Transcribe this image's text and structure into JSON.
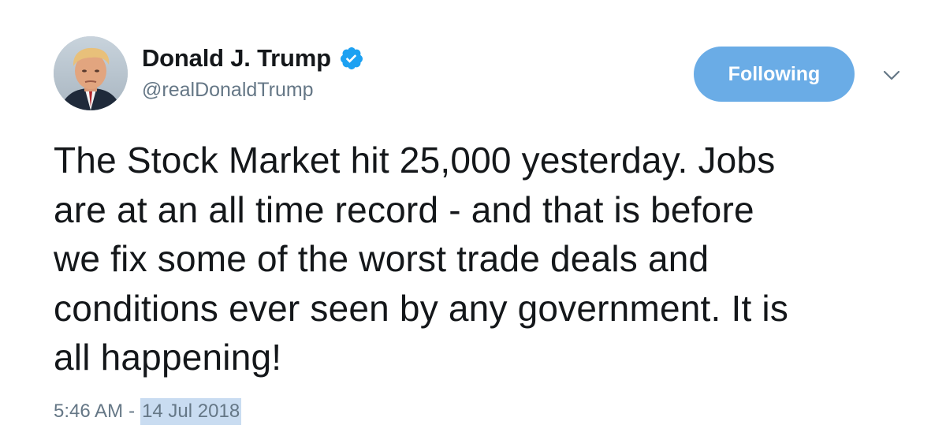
{
  "tweet": {
    "author": {
      "display_name": "Donald J. Trump",
      "handle": "@realDonaldTrump",
      "verified_icon": "verified-badge-icon",
      "avatar_icon": "avatar"
    },
    "follow_button": {
      "label": "Following"
    },
    "menu_icon": "chevron-down-icon",
    "text": "The Stock Market hit 25,000 yesterday. Jobs\nare at an all time record - and that is before\nwe fix some of the worst trade deals and\nconditions ever seen by any government. It is\nall happening!",
    "time": "5:46 AM",
    "separator": "-",
    "date": "14 Jul 2018"
  },
  "colors": {
    "accent": "#1da1f2",
    "following_button_bg": "#6aace6",
    "secondary_text": "#657786",
    "primary_text": "#14171a",
    "selection_highlight": "#c9dcf1"
  }
}
